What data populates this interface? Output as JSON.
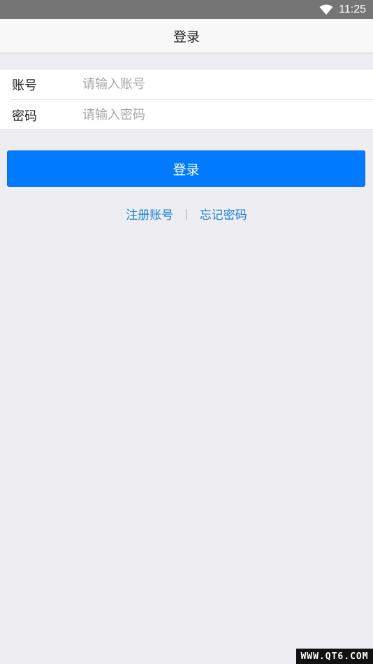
{
  "status_bar": {
    "time": "11:25",
    "wifi_icon": "wifi-icon"
  },
  "header": {
    "title": "登录"
  },
  "form": {
    "account": {
      "label": "账号",
      "value": "",
      "placeholder": "请输入账号"
    },
    "password": {
      "label": "密码",
      "value": "",
      "placeholder": "请输入密码"
    }
  },
  "actions": {
    "login_label": "登录",
    "register_label": "注册账号",
    "separator": "|",
    "forgot_label": "忘记密码"
  },
  "watermark": {
    "text": "WWW.QT6.COM"
  },
  "colors": {
    "primary": "#007aff",
    "link": "#1a82d6",
    "background": "#eeeef2",
    "status_bar": "#757575"
  }
}
